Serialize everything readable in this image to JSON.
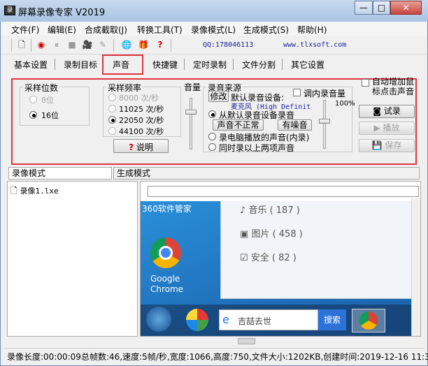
{
  "window": {
    "title": "屏幕录像专家 V2019",
    "controls": {
      "minimize": "—",
      "maximize": "□",
      "close": "✕"
    }
  },
  "menu": [
    "文件(F)",
    "编辑(E)",
    "合成截取(J)",
    "转换工具(T)",
    "录像模式(L)",
    "生成模式(S)",
    "帮助(H)"
  ],
  "toolbar": {
    "qq": "QQ:178046113",
    "site": "www.tlxsoft.com"
  },
  "tabs": [
    "基本设置",
    "录制目标",
    "声音",
    "快捷键",
    "定时录制",
    "文件分割",
    "其它设置"
  ],
  "active_tab": "声音",
  "sound": {
    "bits": {
      "label": "采样位数",
      "opt1": "8位",
      "opt2": "16位",
      "selected": "16位"
    },
    "freq": {
      "label": "采样频率",
      "opts": [
        "8000 次/秒",
        "11025 次/秒",
        "22050 次/秒",
        "44100 次/秒"
      ],
      "selected": "22050 次/秒"
    },
    "explain_button": "说明",
    "volume_label": "音量",
    "source": {
      "label": "录音来源",
      "modify_button": "修改",
      "default_device_label": "默认录音设备:",
      "adjust_inner_volume": "调内录音量",
      "device_name": "麦克风 (High Definit",
      "percent": "100%",
      "opt_default": "从默认录音设备录音",
      "btn_abnormal": "声音不正常",
      "btn_noise": "有噪音",
      "opt_internal": "录电脑播放的声音(内录)",
      "opt_both": "同时录以上两项声音"
    },
    "auto_increase_label": "自动增加鼠标点击声音",
    "test_button": "试录",
    "play_button": "播放",
    "save_button": "保存"
  },
  "lower_tabs": [
    "录像模式",
    "生成模式"
  ],
  "files": [
    "录像1.lxe"
  ],
  "preview": {
    "label_360": "360软件管家",
    "music": "音乐 ( 187 )",
    "pictures": "图片 ( 458 )",
    "security": "安全 ( 82 )",
    "chrome_label": "Google Chrome",
    "search_placeholder": "吉喆去世",
    "search_button": "搜索"
  },
  "status": "录像长度:00:00:09总帧数:46,速度:5帧/秒,宽度:1066,高度:750,文件大小:1202KB,创建时间:2019-12-16 11:3",
  "colors": {
    "highlight": "#e0343f",
    "titlebar": "#aac4e3"
  }
}
